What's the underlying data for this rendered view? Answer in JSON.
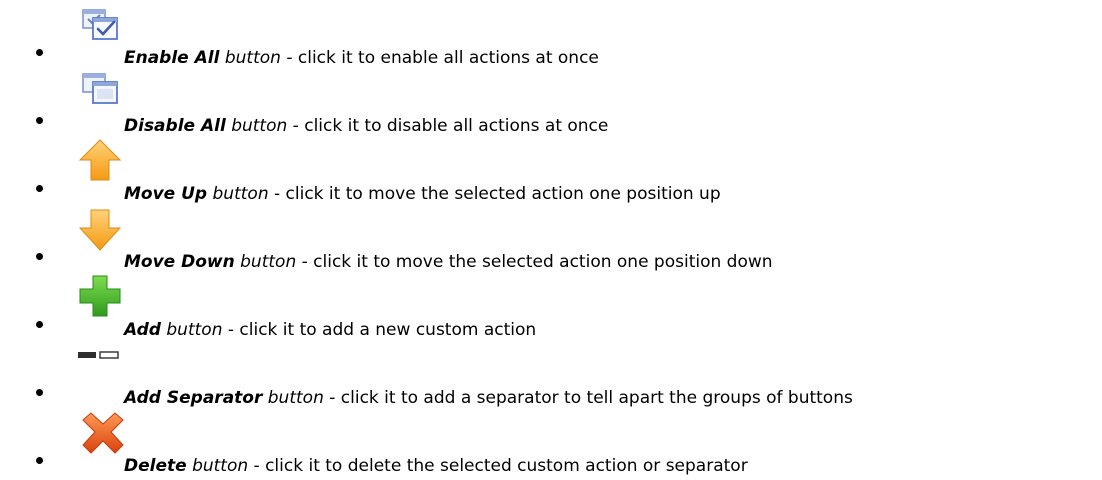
{
  "items": [
    {
      "name": "Enable All",
      "kind": "button",
      "description": " - click it to enable all actions at once",
      "icon": "enable-all-icon"
    },
    {
      "name": "Disable All",
      "kind": "button",
      "description": " - click it to disable all actions at once",
      "icon": "disable-all-icon"
    },
    {
      "name": "Move Up",
      "kind": "button",
      "description": " - click it to move the selected action one position up",
      "icon": "arrow-up-icon"
    },
    {
      "name": "Move Down",
      "kind": "button",
      "description": " - click it to move the selected action one position down",
      "icon": "arrow-down-icon"
    },
    {
      "name": "Add",
      "kind": "button",
      "description": " - click it to add a new custom action",
      "icon": "plus-icon"
    },
    {
      "name": "Add Separator",
      "kind": "button",
      "description": " - click it to add a separator to tell apart the groups of buttons",
      "icon": "separator-icon"
    },
    {
      "name": "Delete",
      "kind": "button",
      "description": " - click it to delete the selected custom action or separator",
      "icon": "delete-x-icon"
    }
  ],
  "colors": {
    "arrow_orange": "#f5a21c",
    "plus_green": "#4fb52c",
    "delete_orange": "#e85c1c",
    "window_blue": "#5c78c8"
  }
}
